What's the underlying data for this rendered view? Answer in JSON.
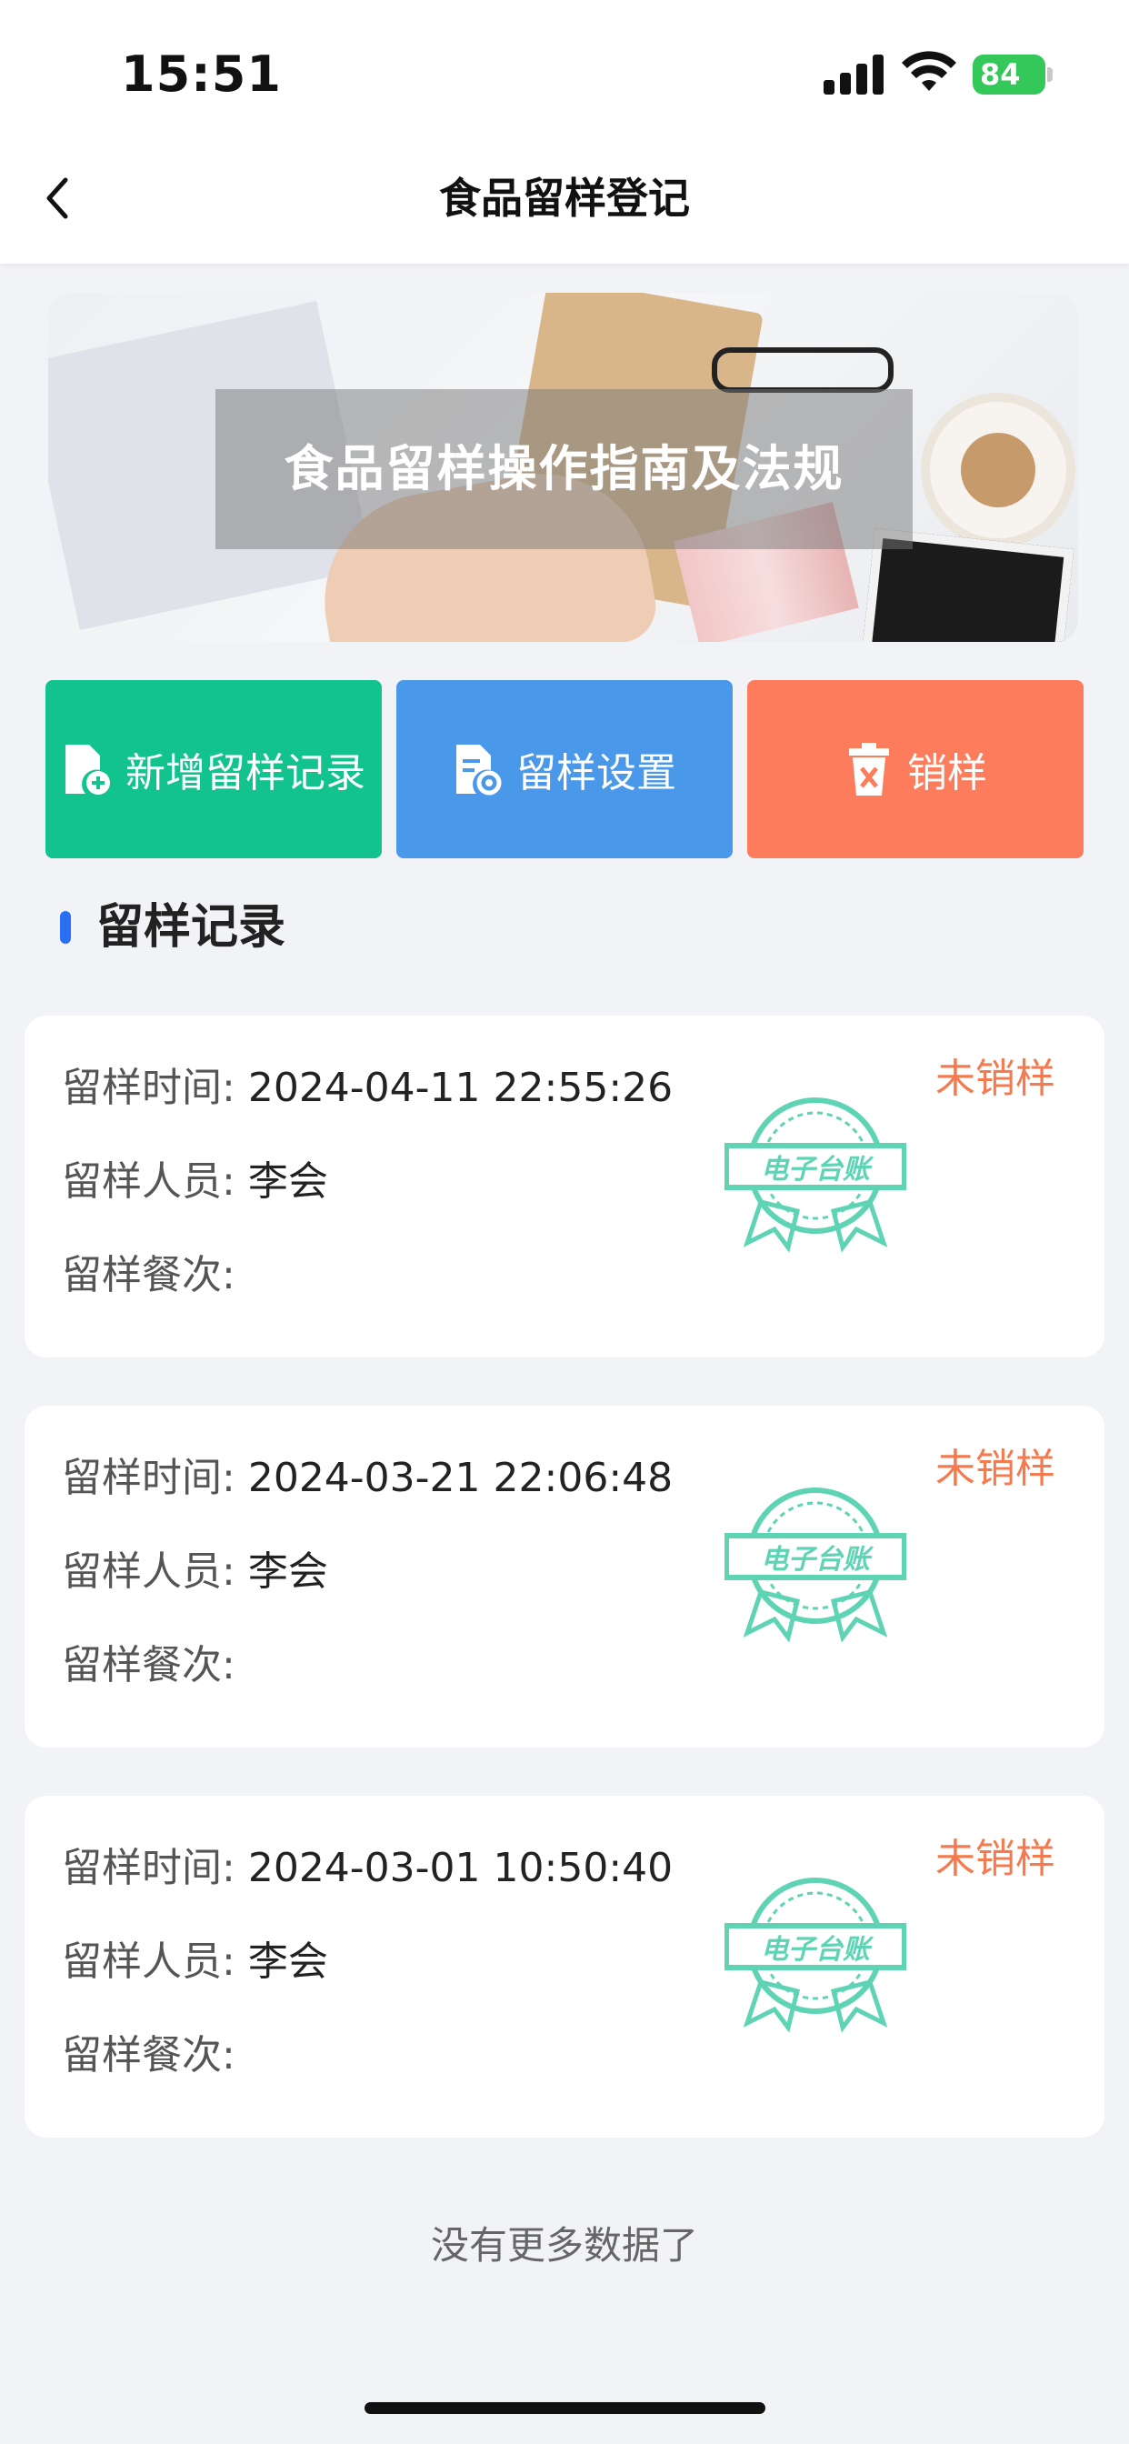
{
  "status_bar": {
    "time": "15:51",
    "battery": "84"
  },
  "nav": {
    "title": "食品留样登记"
  },
  "banner": {
    "text": "食品留样操作指南及法规"
  },
  "actions": [
    {
      "label": "新增留样记录",
      "icon": "add-document-icon",
      "color": "#12c38d"
    },
    {
      "label": "留样设置",
      "icon": "document-settings-icon",
      "color": "#4a98ea"
    },
    {
      "label": "销样",
      "icon": "trash-icon",
      "color": "#fc7c5b"
    }
  ],
  "section": {
    "title": "留样记录"
  },
  "records": [
    {
      "time_label": "留样时间:",
      "time": "2024-04-11 22:55:26",
      "person_label": "留样人员:",
      "person": "李会",
      "meal_label": "留样餐次:",
      "meal": "",
      "status": "未销样",
      "stamp": "电子台账"
    },
    {
      "time_label": "留样时间:",
      "time": "2024-03-21 22:06:48",
      "person_label": "留样人员:",
      "person": "李会",
      "meal_label": "留样餐次:",
      "meal": "",
      "status": "未销样",
      "stamp": "电子台账"
    },
    {
      "time_label": "留样时间:",
      "time": "2024-03-01 10:50:40",
      "person_label": "留样人员:",
      "person": "李会",
      "meal_label": "留样餐次:",
      "meal": "",
      "status": "未销样",
      "stamp": "电子台账"
    }
  ],
  "footer": {
    "note": "没有更多数据了"
  },
  "colors": {
    "status": "#f47a4f",
    "stamp": "#5fd4b4",
    "accent": "#2b6ff3"
  }
}
